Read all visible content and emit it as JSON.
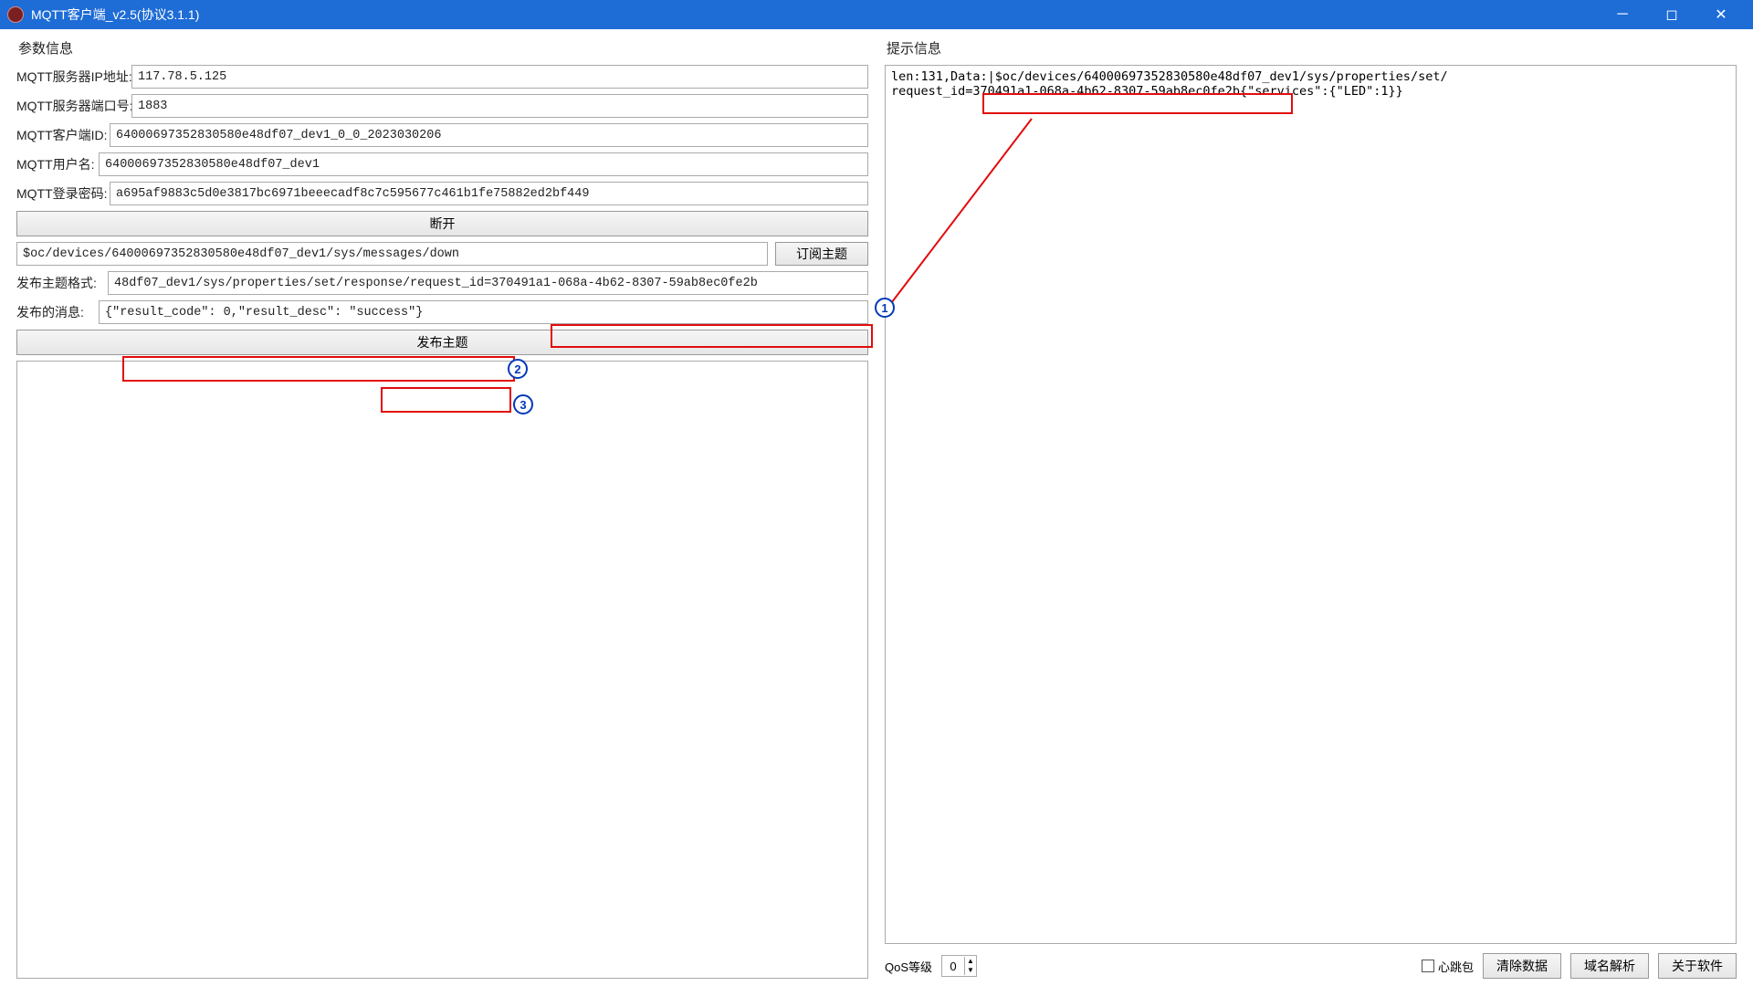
{
  "window": {
    "title": "MQTT客户端_v2.5(协议3.1.1)"
  },
  "left": {
    "section_title": "参数信息",
    "server_ip_label": "MQTT服务器IP地址:",
    "server_ip_value": "117.78.5.125",
    "server_port_label": "MQTT服务器端口号:",
    "server_port_value": "1883",
    "client_id_label": "MQTT客户端ID:",
    "client_id_value": "64000697352830580e48df07_dev1_0_0_2023030206",
    "username_label": "MQTT用户名:",
    "username_value": "64000697352830580e48df07_dev1",
    "password_label": "MQTT登录密码:",
    "password_value": "a695af9883c5d0e3817bc6971beeecadf8c7c595677c461b1fe75882ed2bf449",
    "disconnect_button": "断开",
    "subscribe_topic_value": "$oc/devices/64000697352830580e48df07_dev1/sys/messages/down",
    "subscribe_button": "订阅主题",
    "publish_topic_label": "发布主题格式:",
    "publish_topic_value": "48df07_dev1/sys/properties/set/response/request_id=370491a1-068a-4b62-8307-59ab8ec0fe2b",
    "publish_message_label": "发布的消息:",
    "publish_message_value": "{\"result_code\": 0,\"result_desc\": \"success\"}",
    "publish_button": "发布主题"
  },
  "right": {
    "section_title": "提示信息",
    "log_line1": "len:131,Data:|$oc/devices/64000697352830580e48df07_dev1/sys/properties/set/",
    "log_line2": "request_id=370491a1-068a-4b62-8307-59ab8ec0fe2b{\"services\":{\"LED\":1}}",
    "qos_label": "QoS等级",
    "qos_value": "0",
    "heartbeat_label": "心跳包",
    "clear_button": "清除数据",
    "dns_button": "域名解析",
    "about_button": "关于软件"
  },
  "annotations": {
    "step1": "1",
    "step2": "2",
    "step3": "3"
  }
}
